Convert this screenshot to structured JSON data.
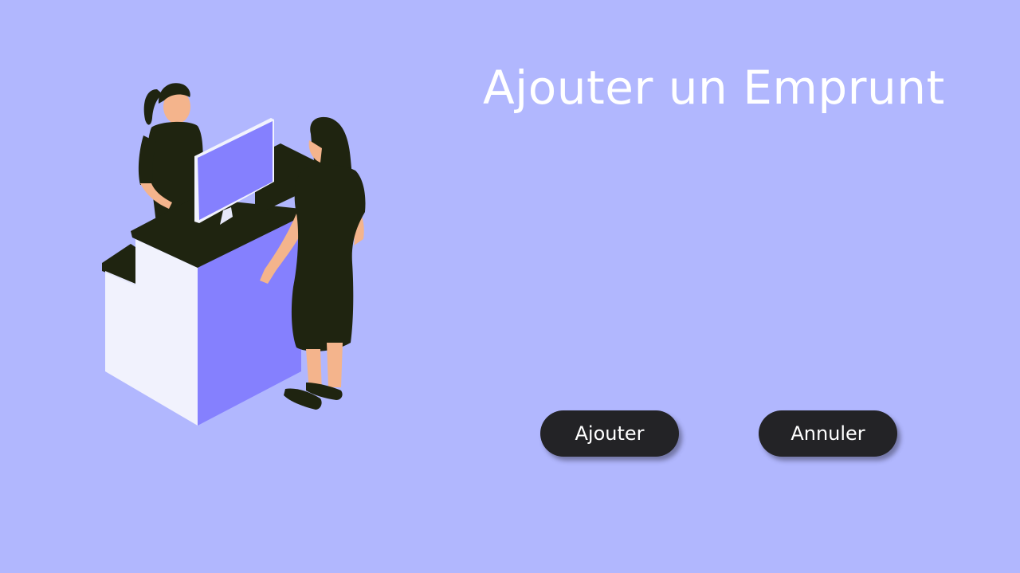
{
  "page": {
    "title": "Ajouter un Emprunt",
    "background_color": "#b1b7fe"
  },
  "illustration": {
    "icon": "librarian-desk-illustration"
  },
  "actions": {
    "add_label": "Ajouter",
    "cancel_label": "Annuler",
    "button_color": "#232326"
  }
}
